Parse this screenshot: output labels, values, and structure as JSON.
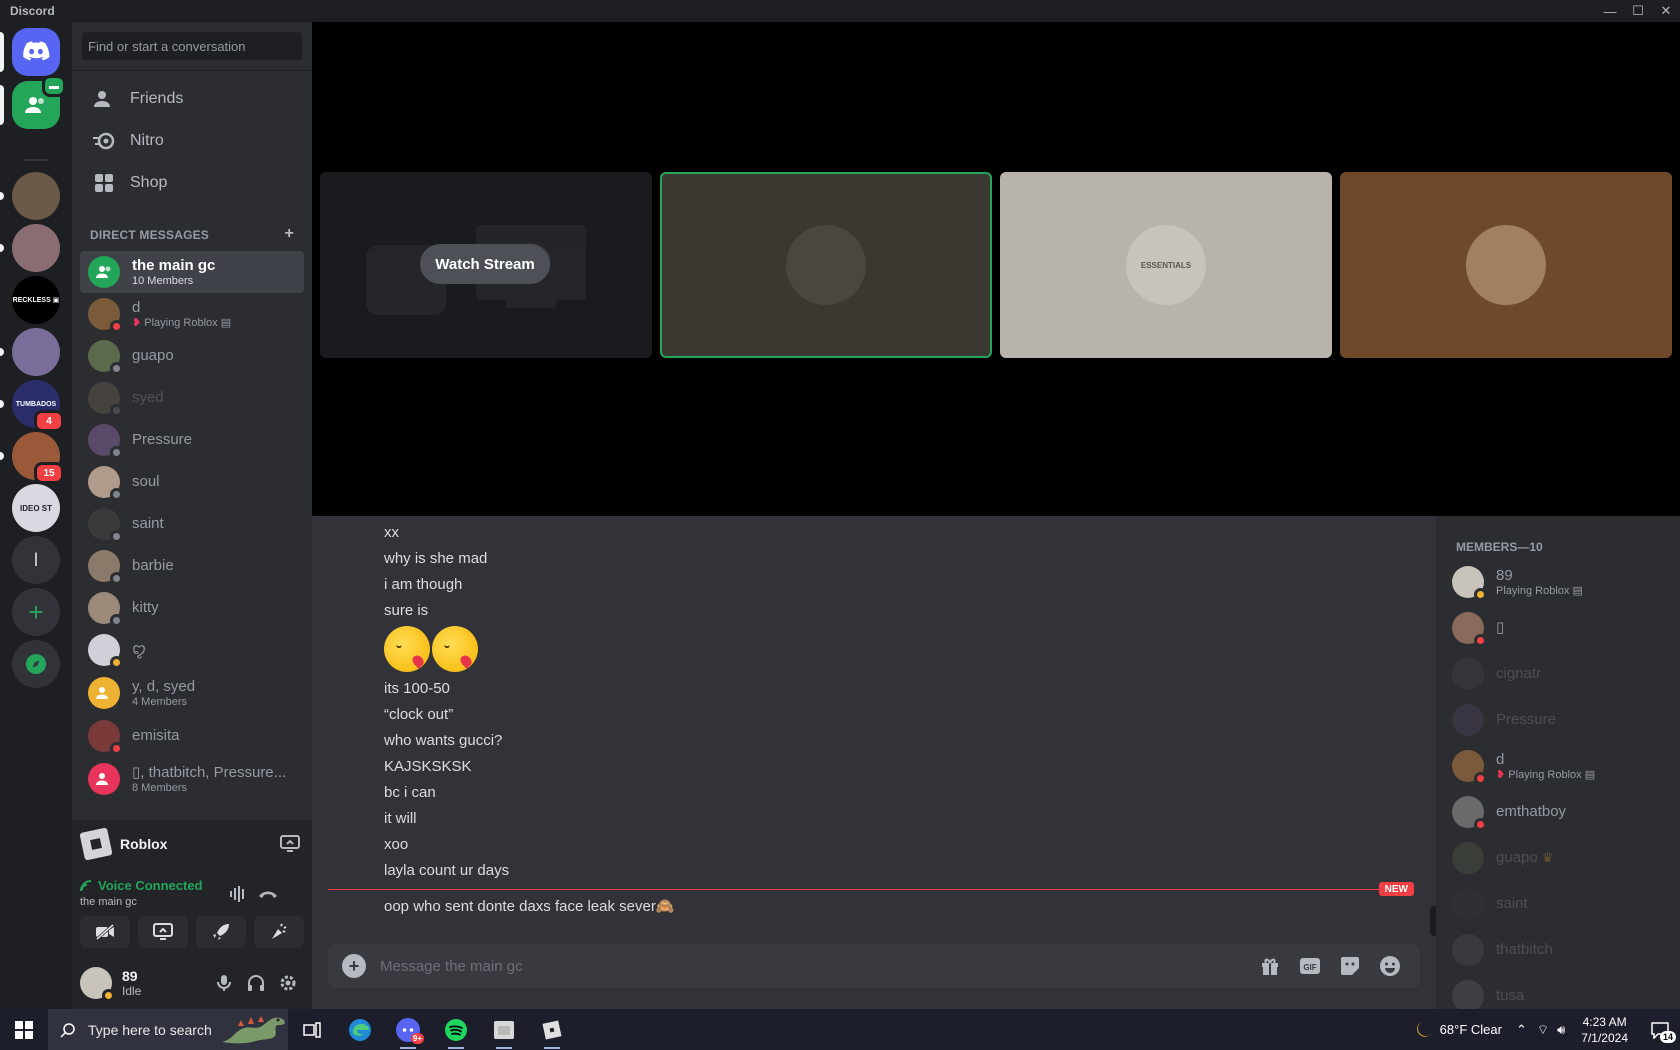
{
  "window": {
    "title": "Discord",
    "controls": [
      "—",
      "☐",
      "✕"
    ]
  },
  "servers": [
    {
      "name": "Direct Messages",
      "icon": "discord-logo-icon",
      "color": "#5865f2",
      "badge": ""
    },
    {
      "name": "Friends GC",
      "icon": "group-icon",
      "color": "#23a55a",
      "badge": ""
    },
    {
      "name": "server-3",
      "icon": "server-avatar",
      "color": "#6b5a4a",
      "badge": ""
    },
    {
      "name": "server-4",
      "icon": "server-avatar",
      "color": "#8a6e73",
      "badge": ""
    },
    {
      "name": "RECKLESS",
      "icon": "reckless-logo",
      "color": "#000000",
      "label": "RECKLESS ▣",
      "badge": ""
    },
    {
      "name": "server-6",
      "icon": "server-avatar",
      "color": "#7a6d9a",
      "badge": ""
    },
    {
      "name": "TUMBADOS",
      "icon": "tumbados-logo",
      "color": "#2b2d6b",
      "label": "TUMBADOS",
      "badge": "4"
    },
    {
      "name": "server-8",
      "icon": "server-avatar",
      "color": "#9a5a3a",
      "badge": "15"
    },
    {
      "name": "VIDEO STORE",
      "icon": "video-store-logo",
      "color": "#d8d8e0",
      "label": "IDEO ST",
      "badge": ""
    },
    {
      "name": "l",
      "icon": "letter-l",
      "color": "#313338",
      "label": "l",
      "badge": ""
    },
    {
      "name": "Add a Server",
      "icon": "plus-icon",
      "color": "#313338",
      "label": "+",
      "badge": ""
    },
    {
      "name": "Discover",
      "icon": "compass-icon",
      "color": "#313338",
      "badge": ""
    }
  ],
  "sidebar": {
    "search_placeholder": "Find or start a conversation",
    "nav": [
      {
        "label": "Friends",
        "icon": "friends-icon"
      },
      {
        "label": "Nitro",
        "icon": "nitro-icon"
      },
      {
        "label": "Shop",
        "icon": "shop-icon"
      }
    ],
    "dm_header": "DIRECT MESSAGES",
    "dm_add": "+",
    "dms": [
      {
        "name": "the main gc",
        "sub": "10 Members",
        "color": "#23a55a",
        "group": true,
        "active": true
      },
      {
        "name": "d",
        "sub": "Playing Roblox",
        "color": "#7a5a3a",
        "status": "dnd"
      },
      {
        "name": "guapo",
        "sub": "",
        "color": "#5a6a4a",
        "status": "offline"
      },
      {
        "name": "syed",
        "sub": "",
        "color": "#7a6a5a",
        "status": "offline",
        "faded": true
      },
      {
        "name": "Pressure",
        "sub": "",
        "color": "#5a4a6a",
        "status": "offline"
      },
      {
        "name": "soul",
        "sub": "",
        "color": "#b09a8a",
        "status": "offline"
      },
      {
        "name": "saint",
        "sub": "",
        "color": "#3a3a3a",
        "status": "offline"
      },
      {
        "name": "barbie",
        "sub": "",
        "color": "#8a7a6a",
        "status": "offline"
      },
      {
        "name": "kitty",
        "sub": "",
        "color": "#9a8a7a",
        "status": "offline"
      },
      {
        "name": "ꨄ",
        "sub": "",
        "color": "#d0d0d8",
        "status": "idle"
      },
      {
        "name": "y, d, syed",
        "sub": "4 Members",
        "color": "#f0b232",
        "group": true
      },
      {
        "name": "emisita",
        "sub": "",
        "color": "#7a3a3a",
        "status": "dnd"
      },
      {
        "name": "▯, thatbitch, Pressure...",
        "sub": "8 Members",
        "color": "#e8345a",
        "group": true
      }
    ]
  },
  "activity": {
    "game": "Roblox"
  },
  "voice": {
    "status": "Voice Connected",
    "channel": "the main gc"
  },
  "user": {
    "name": "89",
    "status": "Idle"
  },
  "stream": {
    "watch_label": "Watch Stream",
    "tiles": [
      {
        "type": "stream",
        "bg": "#1a1b1e"
      },
      {
        "type": "avatar",
        "bg": "#3a3830",
        "avatar_color": "#4a4640",
        "speaking": true
      },
      {
        "type": "avatar",
        "bg": "#b8b4ac",
        "avatar_color": "#c8c4bc",
        "label": "ESSENTIALS"
      },
      {
        "type": "avatar",
        "bg": "#6e4a2a",
        "avatar_color": "#a08060"
      }
    ]
  },
  "chat": {
    "messages": [
      "xx",
      "why is she mad",
      "i am though",
      "sure is",
      "",
      "its 100-50",
      "“clock out”",
      "who wants gucci?",
      "KAJSKSKSK",
      "bc i can",
      "it will",
      "xoo",
      "layla count ur days"
    ],
    "new_label": "NEW",
    "last_message": "oop who sent donte daxs face leak sever🙈",
    "composer_placeholder": "Message the main gc"
  },
  "members": {
    "header": "MEMBERS—10",
    "list": [
      {
        "name": "89",
        "sub": "Playing Roblox",
        "color": "#c8c4bc",
        "status": "idle"
      },
      {
        "name": "▯",
        "sub": "",
        "color": "#8a6a5a",
        "status": "dnd"
      },
      {
        "name": "cignatr",
        "sub": "",
        "color": "#4a4a4a",
        "offline": true
      },
      {
        "name": "Pressure",
        "sub": "",
        "color": "#5a4a6a",
        "offline": true
      },
      {
        "name": "d",
        "sub": "Playing Roblox",
        "color": "#7a5a3a",
        "status": "dnd"
      },
      {
        "name": "emthatboy",
        "sub": "",
        "color": "#6a6a6a",
        "status": "dnd"
      },
      {
        "name": "guapo",
        "sub": "",
        "color": "#5a6a4a",
        "offline": true,
        "owner": true
      },
      {
        "name": "saint",
        "sub": "",
        "color": "#3a3a3a",
        "offline": true
      },
      {
        "name": "thatbitch",
        "sub": "",
        "color": "#5a5a5a",
        "offline": true
      },
      {
        "name": "tusa",
        "sub": "",
        "color": "#6a6a6a",
        "offline": true
      }
    ]
  },
  "taskbar": {
    "search_placeholder": "Type here to search",
    "weather": "68°F  Clear",
    "time": "4:23 AM",
    "date": "7/1/2024",
    "notifications": "14",
    "discord_badge": "9+"
  }
}
